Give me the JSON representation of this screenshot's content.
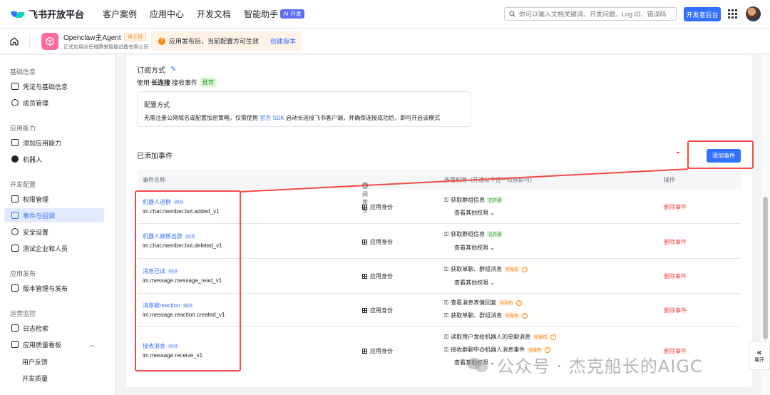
{
  "topnav": {
    "logo_text": "飞书开放平台",
    "items": [
      "客户案例",
      "应用中心",
      "开发文档",
      "智能助手"
    ],
    "ai_badge": "AI 开发",
    "search_placeholder": "你可以输入文档关键词、开发问题、Log ID、错误码",
    "dev_console": "开发者后台"
  },
  "appbar": {
    "app_name": "Openclaw主Agent",
    "status": "待上线",
    "app_sub": "正式应用@岳城腾誉智能设备有限公司",
    "notice_text": "应用发布后，当前配置方可生效",
    "notice_link": "创建版本"
  },
  "sidebar": {
    "groups": [
      "基础信息",
      "应用能力",
      "开发配置",
      "应用发布",
      "运营监控"
    ],
    "items": {
      "credentials": "凭证与基础信息",
      "members": "成员管理",
      "add_capability": "添加应用能力",
      "bot": "机器人",
      "permissions": "权限管理",
      "events": "事件与回调",
      "security": "安全设置",
      "test_enterprise": "测试企业和人员",
      "version": "版本管理与发布",
      "logs": "日志检索",
      "quality": "应用质量看板",
      "feedback": "用户反馈",
      "dev_quality": "开发质量"
    }
  },
  "subscription": {
    "title": "订阅方式",
    "use_prefix": "使用",
    "method": "长连接",
    "use_suffix": "接收事件",
    "recommend": "推荐",
    "config_title": "配置方式",
    "config_desc_1": "无需注册公网域名或配置加密策略，仅需使用",
    "config_sdk": "官方 SDK",
    "config_desc_2": "启动长连接飞书客户端，并确保连接成功后，即可开启该模式"
  },
  "events": {
    "title": "已添加事件",
    "add_button": "添加事件",
    "columns": [
      "事件名称",
      "订阅类型",
      "所需权限（开通以下任一权限即可）",
      "操作"
    ],
    "more_perms": "查看其他权限",
    "delete": "删除事件",
    "rows": [
      {
        "name": "机器人进群",
        "version": "v2.0",
        "code": "im.chat.member.bot.added_v1",
        "type": "应用身份",
        "perms": [
          {
            "label": "获取群组信息",
            "badge": "已开通",
            "state": "on"
          }
        ]
      },
      {
        "name": "机器人被移出群",
        "version": "v2.0",
        "code": "im.chat.member.bot.deleted_v1",
        "type": "应用身份",
        "perms": [
          {
            "label": "获取群组信息",
            "badge": "已开通",
            "state": "on"
          }
        ]
      },
      {
        "name": "消息已读",
        "version": "v2.0",
        "code": "im.message.message_read_v1",
        "type": "应用身份",
        "perms": [
          {
            "label": "获取单聊、群组消息",
            "badge": "待发布",
            "state": "pending"
          }
        ]
      },
      {
        "name": "消息被reaction",
        "version": "v2.0",
        "code": "im.message.reaction.created_v1",
        "type": "应用身份",
        "perms": [
          {
            "label": "查看消息表情回复",
            "badge": "待发布",
            "state": "pending"
          },
          {
            "label": "获取单聊、群组消息",
            "badge": "待发布",
            "state": "pending"
          }
        ]
      },
      {
        "name": "接收消息",
        "version": "v2.0",
        "code": "im.message.receive_v1",
        "type": "应用身份",
        "perms": [
          {
            "label": "读取用户发给机器人的单聊消息",
            "badge": "待发布",
            "state": "pending"
          },
          {
            "label": "接收群聊中@机器人消息事件",
            "badge": "待发布",
            "state": "pending"
          }
        ]
      }
    ]
  },
  "watermark": "公众号 · 杰克船长的AIGC",
  "expand_label": "展开",
  "colors": {
    "accent": "#3370ff",
    "danger": "#f54a45",
    "success": "#2ea121",
    "warning": "#ff7d00"
  }
}
